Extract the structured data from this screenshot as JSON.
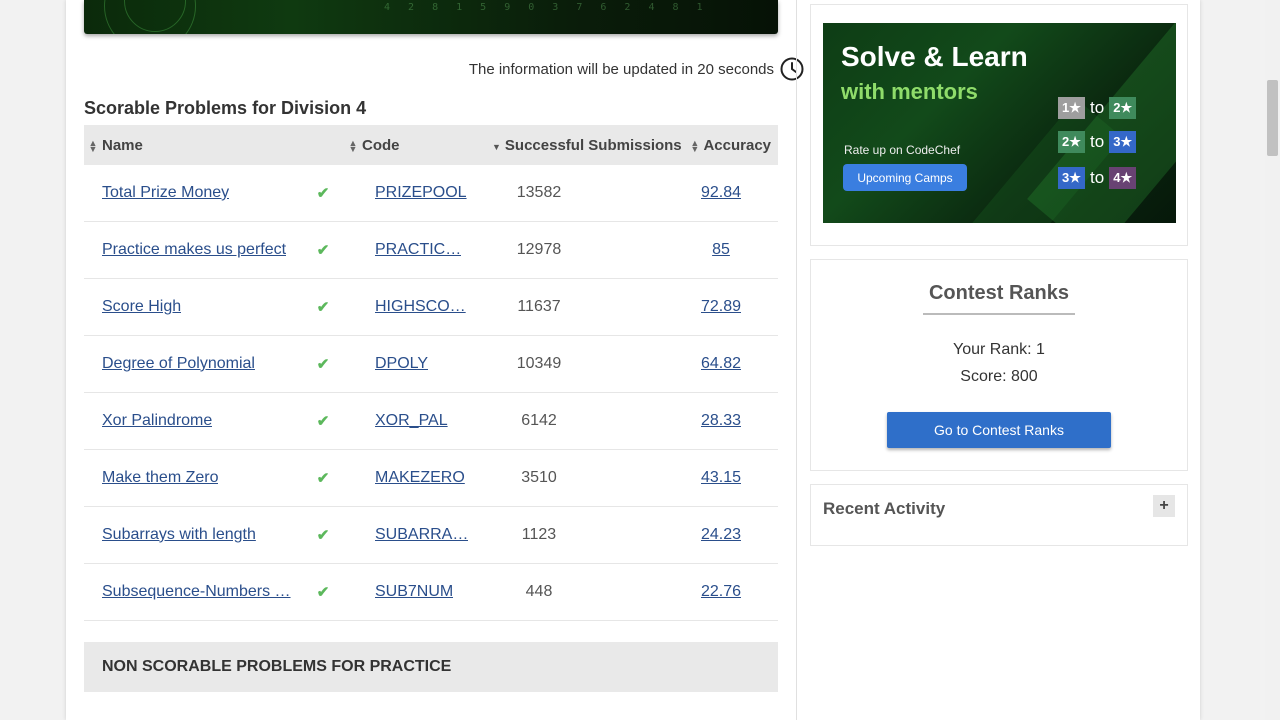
{
  "header": {
    "update_text": "The information will be updated in 20 seconds",
    "banner_digits": "4 2 8 1 5 9 0 3 7 6 2 4 8 1"
  },
  "section": {
    "title": "Scorable Problems for Division 4"
  },
  "table": {
    "columns": [
      "Name",
      "Code",
      "Successful Submissions",
      "Accuracy"
    ],
    "rows": [
      {
        "name": "Total Prize Money",
        "code": "PRIZEPOOL",
        "submissions": "13582",
        "accuracy": "92.84"
      },
      {
        "name": "Practice makes us perfect",
        "code": "PRACTIC…",
        "submissions": "12978",
        "accuracy": "85"
      },
      {
        "name": "Score High",
        "code": "HIGHSCO…",
        "submissions": "11637",
        "accuracy": "72.89"
      },
      {
        "name": "Degree of Polynomial",
        "code": "DPOLY",
        "submissions": "10349",
        "accuracy": "64.82"
      },
      {
        "name": "Xor Palindrome",
        "code": "XOR_PAL",
        "submissions": "6142",
        "accuracy": "28.33"
      },
      {
        "name": "Make them Zero",
        "code": "MAKEZERO",
        "submissions": "3510",
        "accuracy": "43.15"
      },
      {
        "name": "Subarrays with length",
        "code": "SUBARRA…",
        "submissions": "1123",
        "accuracy": "24.23"
      },
      {
        "name": "Subsequence-Numbers …",
        "code": "SUB7NUM",
        "submissions": "448",
        "accuracy": "22.76"
      }
    ],
    "solved_icon": "check-icon"
  },
  "non_scorable": {
    "title": "NON SCORABLE PROBLEMS FOR PRACTICE"
  },
  "ad": {
    "title_line1": "Solve & Learn",
    "title_line2": "with mentors",
    "subtitle": "Rate up on CodeChef",
    "button_label": "Upcoming Camps",
    "ranks": [
      {
        "from": "1★",
        "to_word": "to",
        "to": "2★"
      },
      {
        "from": "2★",
        "to_word": "to",
        "to": "3★"
      },
      {
        "from": "3★",
        "to_word": "to",
        "to": "4★"
      }
    ],
    "star_colors": {
      "1": "#9e9e9e",
      "2": "#3f8a5c",
      "3": "#3468c8",
      "4": "#684273"
    }
  },
  "contest_ranks": {
    "title": "Contest Ranks",
    "your_rank": "Your Rank: 1",
    "score": "Score: 800",
    "button_label": "Go to Contest Ranks"
  },
  "recent_activity": {
    "title": "Recent Activity",
    "expand_label": "+"
  }
}
